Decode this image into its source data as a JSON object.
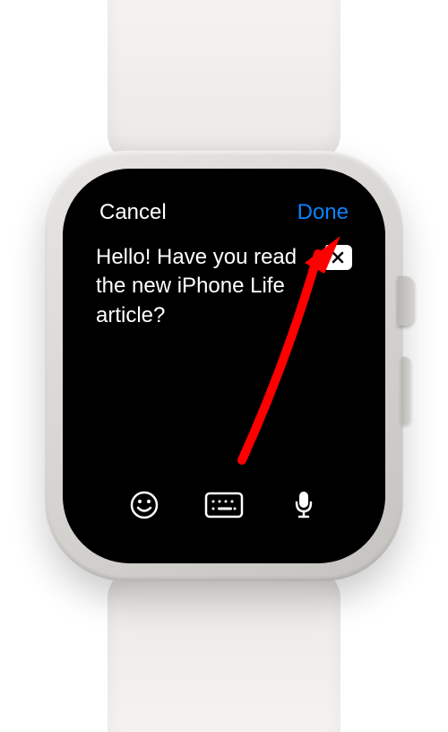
{
  "header": {
    "cancel_label": "Cancel",
    "done_label": "Done"
  },
  "message": {
    "text": "Hello! Have you read the new iPhone Life article?"
  },
  "toolbar": {
    "emoji_glyph": "😀"
  },
  "icons": {
    "backspace": "backspace-icon",
    "emoji": "emoji-icon",
    "keyboard": "keyboard-icon",
    "microphone": "microphone-icon"
  },
  "colors": {
    "done_color": "#0a84ff",
    "text_color": "#ffffff",
    "annotation_color": "#ff0000"
  }
}
